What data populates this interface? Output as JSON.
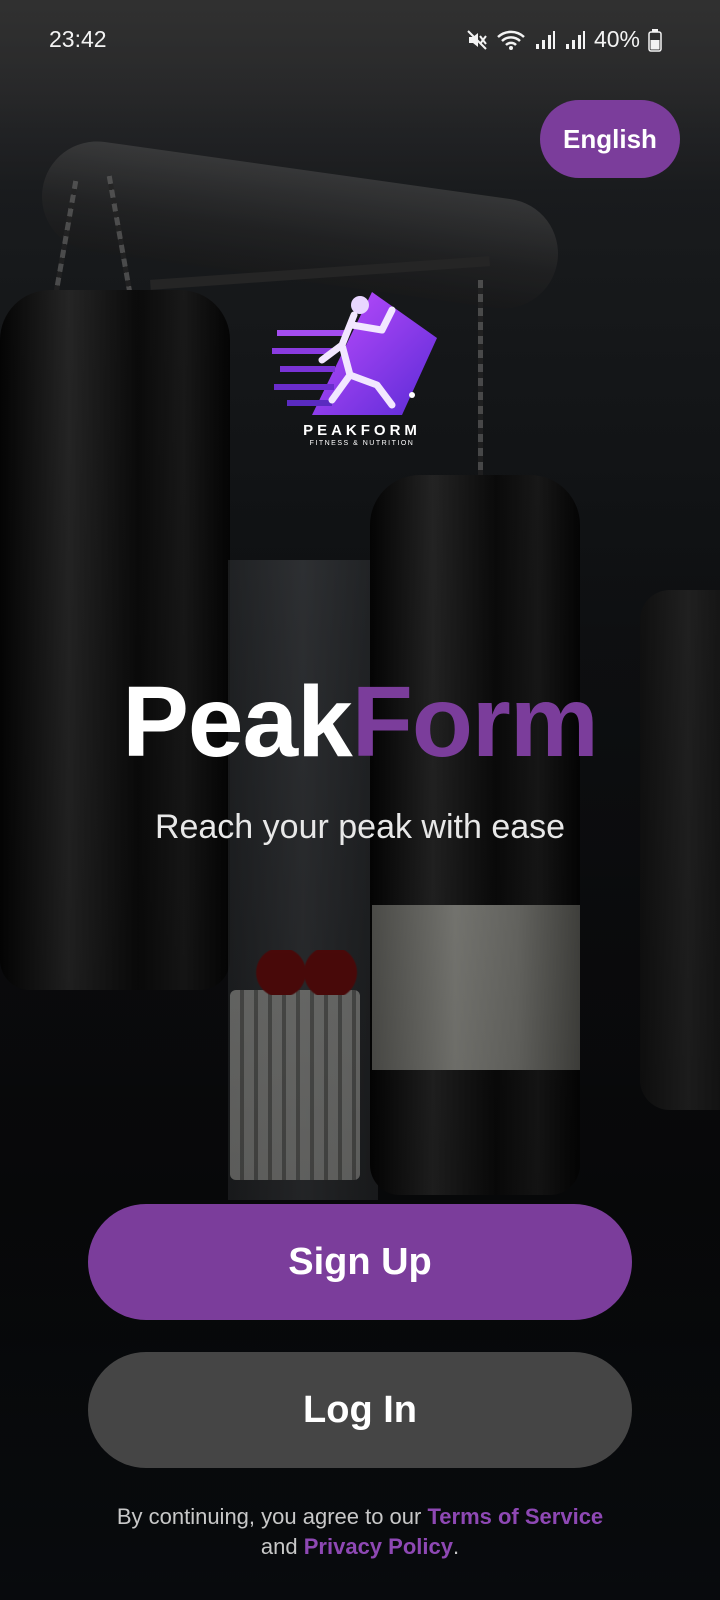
{
  "status_bar": {
    "time": "23:42",
    "battery": "40%",
    "icons": [
      "mute-icon",
      "wifi-icon",
      "signal-icon",
      "signal-icon",
      "battery-icon"
    ]
  },
  "language_button": {
    "label": "English"
  },
  "logo": {
    "wordmark": "PEAKFORM",
    "subtitle": "FITNESS & NUTRITION"
  },
  "title": {
    "part1": "Peak",
    "part2": "Form"
  },
  "tagline": "Reach your peak with ease",
  "buttons": {
    "signup": "Sign Up",
    "login": "Log In"
  },
  "legal": {
    "prefix": "By continuing, you agree to our",
    "terms": "Terms of Service",
    "middle": "and",
    "privacy": "Privacy Policy",
    "suffix": "."
  },
  "colors": {
    "accent": "#7b3d9b",
    "link": "#8e48b4",
    "secondary_button": "#454545"
  }
}
